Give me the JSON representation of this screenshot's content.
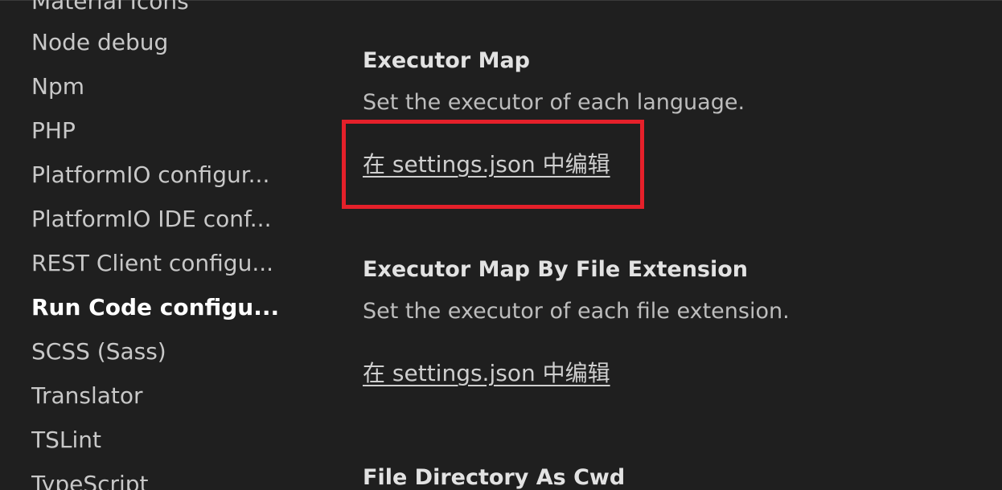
{
  "toc": {
    "items": [
      {
        "label": "Material Icons",
        "active": false
      },
      {
        "label": "Node debug",
        "active": false
      },
      {
        "label": "Npm",
        "active": false
      },
      {
        "label": "PHP",
        "active": false
      },
      {
        "label": "PlatformIO configur...",
        "active": false
      },
      {
        "label": "PlatformIO IDE conf...",
        "active": false
      },
      {
        "label": "REST Client configu...",
        "active": false
      },
      {
        "label": "Run Code configu...",
        "active": true
      },
      {
        "label": "SCSS (Sass)",
        "active": false
      },
      {
        "label": "Translator",
        "active": false
      },
      {
        "label": "TSLint",
        "active": false
      },
      {
        "label": "TypeScript",
        "active": false
      }
    ]
  },
  "settings": {
    "executor_map": {
      "title": "Executor Map",
      "description": "Set the executor of each language.",
      "link": "在 settings.json 中编辑"
    },
    "executor_map_by_ext": {
      "title": "Executor Map By File Extension",
      "description": "Set the executor of each file extension.",
      "link": "在 settings.json 中编辑"
    },
    "file_directory_as_cwd": {
      "title": "File Directory As Cwd"
    }
  },
  "colors": {
    "background": "#1f1f1f",
    "highlight_box": "#e5202a",
    "text_primary": "#e2e2e2",
    "text_secondary": "#bdbdbd"
  }
}
